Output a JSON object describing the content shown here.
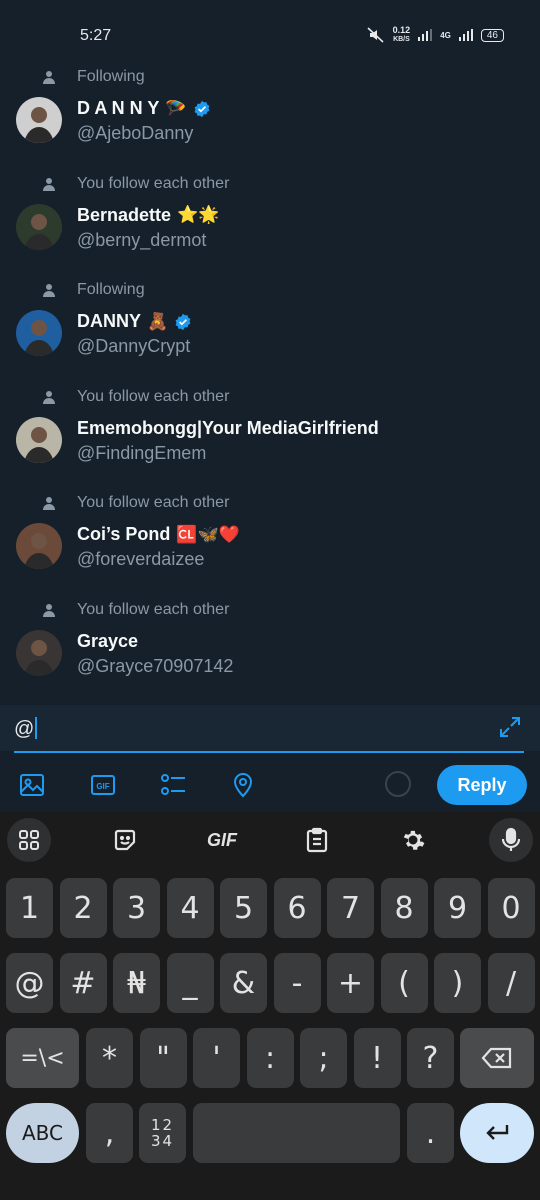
{
  "status_bar": {
    "time": "5:27",
    "net_speed_top": "0.12",
    "net_speed_bottom": "KB/S",
    "network": "4G",
    "battery": "46"
  },
  "suggestions": [
    {
      "context": "Following",
      "name": "D A N N Y",
      "name_emoji": "🪂",
      "verified": true,
      "handle": "@AjeboDanny",
      "avatar_color": "#cfcfcf"
    },
    {
      "context": "You follow each other",
      "name": "Bernadette",
      "name_emoji": "⭐🌟",
      "verified": false,
      "handle": "@berny_dermot",
      "avatar_color": "#2d3b2c"
    },
    {
      "context": "Following",
      "name": "DANNY",
      "name_emoji": "🧸",
      "verified": true,
      "handle": "@DannyCrypt",
      "avatar_color": "#1f5f9f"
    },
    {
      "context": "You follow each other",
      "name": "Ememobongg|Your MediaGirlfriend",
      "name_emoji": "",
      "verified": false,
      "handle": "@FindingEmem",
      "avatar_color": "#b9b6a8"
    },
    {
      "context": "You follow each other",
      "name": "Coi’s Pond",
      "name_emoji": "🆑🦋❤️",
      "verified": false,
      "handle": "@foreverdaizee",
      "avatar_color": "#6b4a3a"
    },
    {
      "context": "You follow each other",
      "name": "Grayce",
      "name_emoji": "",
      "verified": false,
      "handle": "@Grayce70907142",
      "avatar_color": "#3a3535"
    }
  ],
  "compose": {
    "value": "@",
    "reply_label": "Reply"
  },
  "keyboard": {
    "toolbar_gif": "GIF",
    "row1": [
      "1",
      "2",
      "3",
      "4",
      "5",
      "6",
      "7",
      "8",
      "9",
      "0"
    ],
    "row2": [
      "@",
      "#",
      "₦",
      "_",
      "&",
      "-",
      "+",
      "(",
      ")",
      "/"
    ],
    "row3_left": "=\\<",
    "row3": [
      "*",
      "\"",
      "'",
      ":",
      ";",
      "!",
      "?"
    ],
    "row4_abc": "ABC",
    "row4_comma": ",",
    "row4_numpad": "12\n34",
    "row4_period": ".",
    "accent": "#1d9bf0"
  }
}
